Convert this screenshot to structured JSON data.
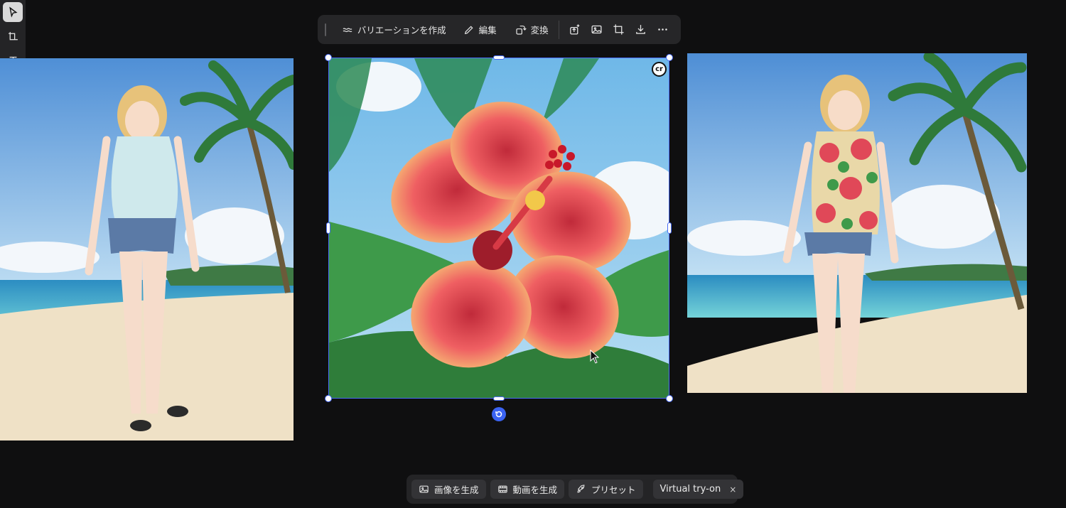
{
  "tool_rail": {
    "tools": [
      {
        "name": "select-tool",
        "icon": "pointer-icon",
        "active": true
      },
      {
        "name": "frame-tool",
        "icon": "frame-icon",
        "active": false
      },
      {
        "name": "text-tool",
        "icon": "text-icon",
        "active": false
      },
      {
        "name": "shape-tool",
        "icon": "rectangle-icon",
        "active": false
      },
      {
        "name": "assets-tool",
        "icon": "assets-icon",
        "active": false
      }
    ]
  },
  "top_toolbar": {
    "variation_label": "バリエーションを作成",
    "edit_label": "編集",
    "transform_label": "変換",
    "icons": [
      "upscale-icon",
      "image-icon",
      "crop-icon",
      "download-icon",
      "more-icon"
    ]
  },
  "canvas": {
    "selected_badge": "cr",
    "accent_color": "#4a6cf7"
  },
  "bottom_toolbar": {
    "generate_image_label": "画像を生成",
    "generate_video_label": "動画を生成",
    "preset_label": "プリセット",
    "virtual_tryon_label": "Virtual try-on",
    "close_glyph": "×"
  }
}
